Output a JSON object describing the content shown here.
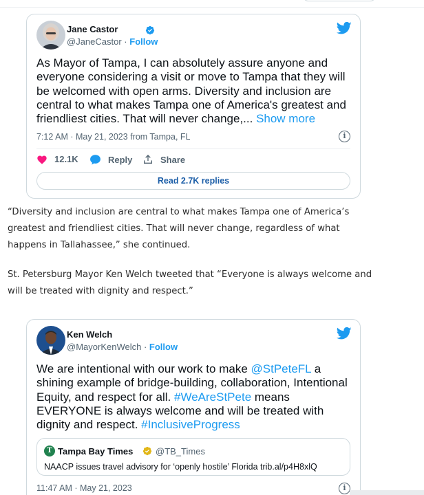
{
  "tweet1": {
    "author_name": "Jane Castor",
    "handle": "@JaneCastor",
    "separator": " · ",
    "follow_label": "Follow",
    "text": "As Mayor of Tampa, I can absolutely assure anyone and everyone considering a visit or move to Tampa that they will be welcomed with open arms. Diversity and inclusion are central to what makes Tampa one of America's greatest and friendliest cities. That will never change,... ",
    "show_more_label": "Show more",
    "timestamp": "7:12 AM · May 21, 2023 from Tampa, FL",
    "likes_count": "12.1K",
    "reply_label": "Reply",
    "share_label": "Share",
    "read_replies_label": "Read 2.7K replies",
    "like_color": "#f91880"
  },
  "article": {
    "paragraph1": "“Diversity and inclusion are central to what makes Tampa one of America’s greatest and friendliest cities. That will never change, regardless of what happens in Tallahassee,” she continued.",
    "paragraph2": "St. Petersburg Mayor Ken Welch tweeted that “Everyone is always welcome and will be treated with dignity and respect.”"
  },
  "tweet2": {
    "author_name": "Ken Welch",
    "handle": "@MayorKenWelch",
    "separator": " · ",
    "follow_label": "Follow",
    "text_part1": "We are intentional with our work to make ",
    "mention": "@StPeteFL",
    "text_part2": " a shining example of bridge-building, collaboration, Intentional Equity, and respect for all. ",
    "hashtag1": "#WeAreStPete",
    "text_part3": " means EVERYONE is always welcome and will be treated with dignity and respect. ",
    "hashtag2": "#InclusiveProgress",
    "quote": {
      "logo_letter": "T",
      "name": "Tampa Bay Times",
      "handle": "@TB_Times",
      "text": "NAACP issues travel advisory for ‘openly hostile’ Florida trib.al/p4H8xlQ"
    },
    "timestamp": "11:47 AM · May 21, 2023"
  },
  "colors": {
    "twitter_blue": "#1d9bf0",
    "gold_badge": "#e2b719"
  },
  "icons": [
    "twitter-bird-icon",
    "verified-badge-icon",
    "heart-icon",
    "reply-icon",
    "share-icon",
    "info-icon"
  ]
}
